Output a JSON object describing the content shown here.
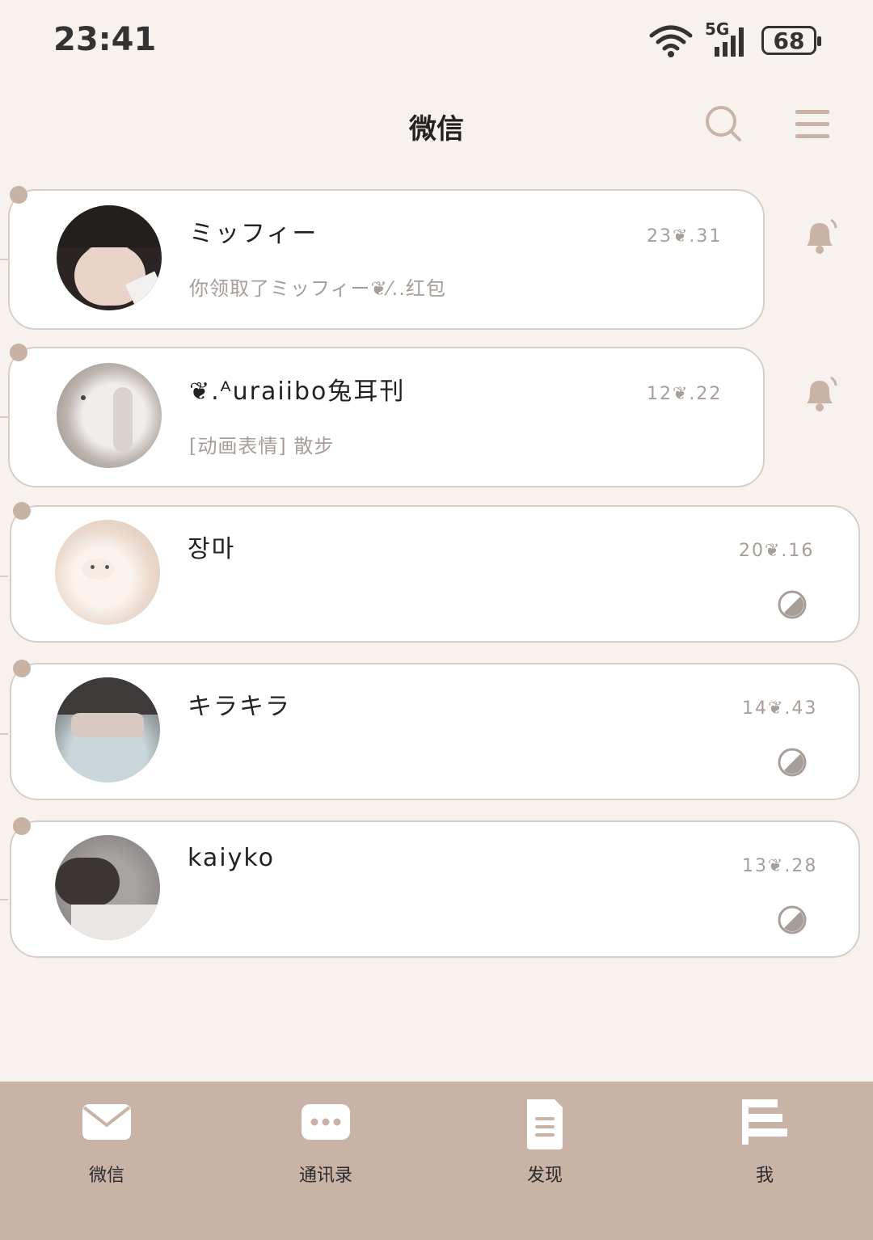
{
  "status_bar": {
    "time": "23:41",
    "network": "5G",
    "battery": "68"
  },
  "header": {
    "title": "微信"
  },
  "chats": [
    {
      "name": "ミッフィー",
      "last_message": "你领取了ミッフィー❦⁄..红包",
      "time": "23❦.31",
      "status_icon": "bell-icon"
    },
    {
      "name": "❦.ᴬuraiibo兔耳刊",
      "last_message": "[动画表情] 散步",
      "time": "12❦.22",
      "status_icon": "bell-icon"
    },
    {
      "name": "장마",
      "last_message": "",
      "time": "20❦.16",
      "status_icon": "read-receipt-icon"
    },
    {
      "name": "キラキラ",
      "last_message": "",
      "time": "14❦.43",
      "status_icon": "read-receipt-icon"
    },
    {
      "name": "kaiyko",
      "last_message": "",
      "time": "13❦.28",
      "status_icon": "read-receipt-icon"
    }
  ],
  "nav": [
    {
      "label": "微信",
      "icon": "envelope-icon"
    },
    {
      "label": "通讯录",
      "icon": "chat-dots-icon"
    },
    {
      "label": "发现",
      "icon": "document-icon"
    },
    {
      "label": "我",
      "icon": "flag-icon"
    }
  ],
  "colors": {
    "background": "#f8f2ef",
    "accent": "#c8b3a6",
    "card_border": "#d9cdc6",
    "muted_text": "#a79d99"
  }
}
